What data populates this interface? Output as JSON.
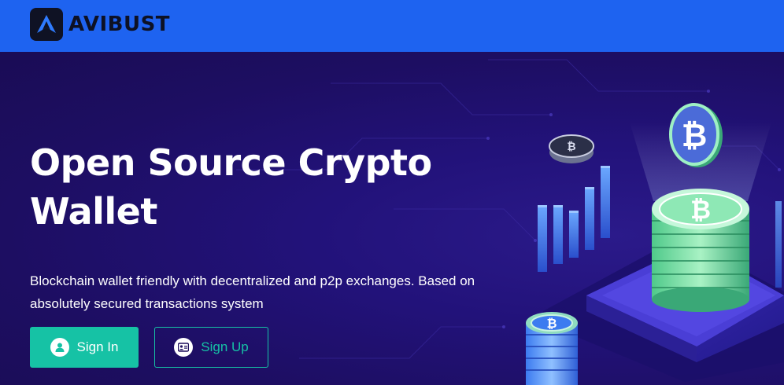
{
  "brand": {
    "name": "AVIBUST"
  },
  "hero": {
    "title": "Open Source Crypto Wallet",
    "description": "Blockchain wallet friendly with decentralized and p2p exchanges. Based on absolutely secured transactions system"
  },
  "buttons": {
    "sign_in": "Sign In",
    "sign_up": "Sign Up"
  },
  "colors": {
    "header": "#1e63f0",
    "background": "#1e0f5c",
    "accent": "#16c2a5",
    "coin": "#7ee0a5"
  },
  "icons": {
    "logo": "avibust-logo-icon",
    "sign_in": "user-icon",
    "sign_up": "id-card-icon"
  }
}
